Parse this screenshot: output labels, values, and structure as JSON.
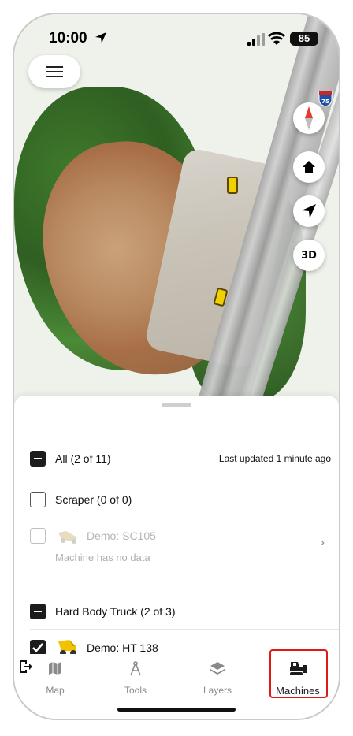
{
  "status_bar": {
    "time": "10:00",
    "battery": "85"
  },
  "map": {
    "highway_shield": "75",
    "controls": {
      "three_d_label": "3D"
    }
  },
  "sheet": {
    "all_group": {
      "label": "All (2 of 11)",
      "last_updated": "Last updated 1 minute ago"
    },
    "scraper_group": {
      "label": "Scraper (0 of 0)",
      "machines": [
        {
          "name": "Demo: SC105",
          "note": "Machine has no data"
        }
      ]
    },
    "truck_group": {
      "label": "Hard Body Truck (2 of 3)",
      "machines": [
        {
          "name": "Demo: HT 138"
        }
      ]
    }
  },
  "tabbar": {
    "tabs": [
      {
        "label": "Map",
        "icon": "map-icon"
      },
      {
        "label": "Tools",
        "icon": "compass-drafting-icon"
      },
      {
        "label": "Layers",
        "icon": "layers-icon"
      },
      {
        "label": "Machines",
        "icon": "bulldozer-icon",
        "active": true
      }
    ]
  },
  "colors": {
    "highlight": "#e01818",
    "checkbox": "#1c1c1c",
    "marker": "#f2d000"
  }
}
